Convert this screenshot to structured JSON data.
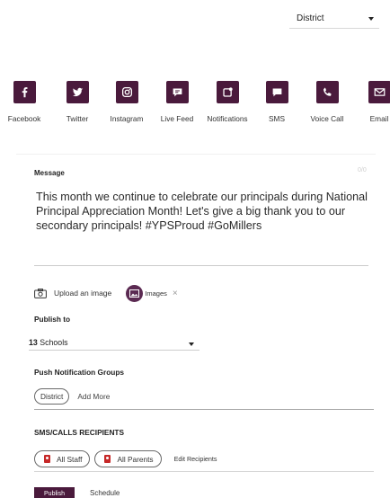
{
  "header": {
    "district_label": "District"
  },
  "channels": [
    {
      "label": "Facebook",
      "icon": "facebook-icon"
    },
    {
      "label": "Twitter",
      "icon": "twitter-icon"
    },
    {
      "label": "Instagram",
      "icon": "instagram-icon"
    },
    {
      "label": "Live Feed",
      "icon": "live-feed-icon"
    },
    {
      "label": "Notifications",
      "icon": "notifications-icon"
    },
    {
      "label": "SMS",
      "icon": "sms-icon"
    },
    {
      "label": "Voice Call",
      "icon": "phone-icon"
    },
    {
      "label": "Email",
      "icon": "email-icon"
    }
  ],
  "message": {
    "heading": "Message",
    "corner_text": "0/0",
    "text": "This month we continue to celebrate our principals during National Principal Appreciation Month! Let's give a big thank you to our secondary principals! #YPSProud #GoMillers"
  },
  "attachments": {
    "upload_label": "Upload an image",
    "chip_label": "Images",
    "close_glyph": "×"
  },
  "publish_to": {
    "heading": "Publish to",
    "count": "13",
    "unit": "Schools"
  },
  "push_groups": {
    "heading": "Push Notification Groups",
    "chip": "District",
    "add_more": "Add More"
  },
  "sms_recipients": {
    "heading": "SMS/CALLS RECIPIENTS",
    "chips": [
      "All Staff",
      "All Parents"
    ],
    "edit": "Edit Recipients"
  },
  "actions": {
    "publish": "Publish",
    "schedule": "Schedule"
  },
  "colors": {
    "brand": "#4a1a3c",
    "chip_accent": "#5b2a52",
    "sms_icon_red": "#c62828",
    "text": "#1a1a1a"
  }
}
